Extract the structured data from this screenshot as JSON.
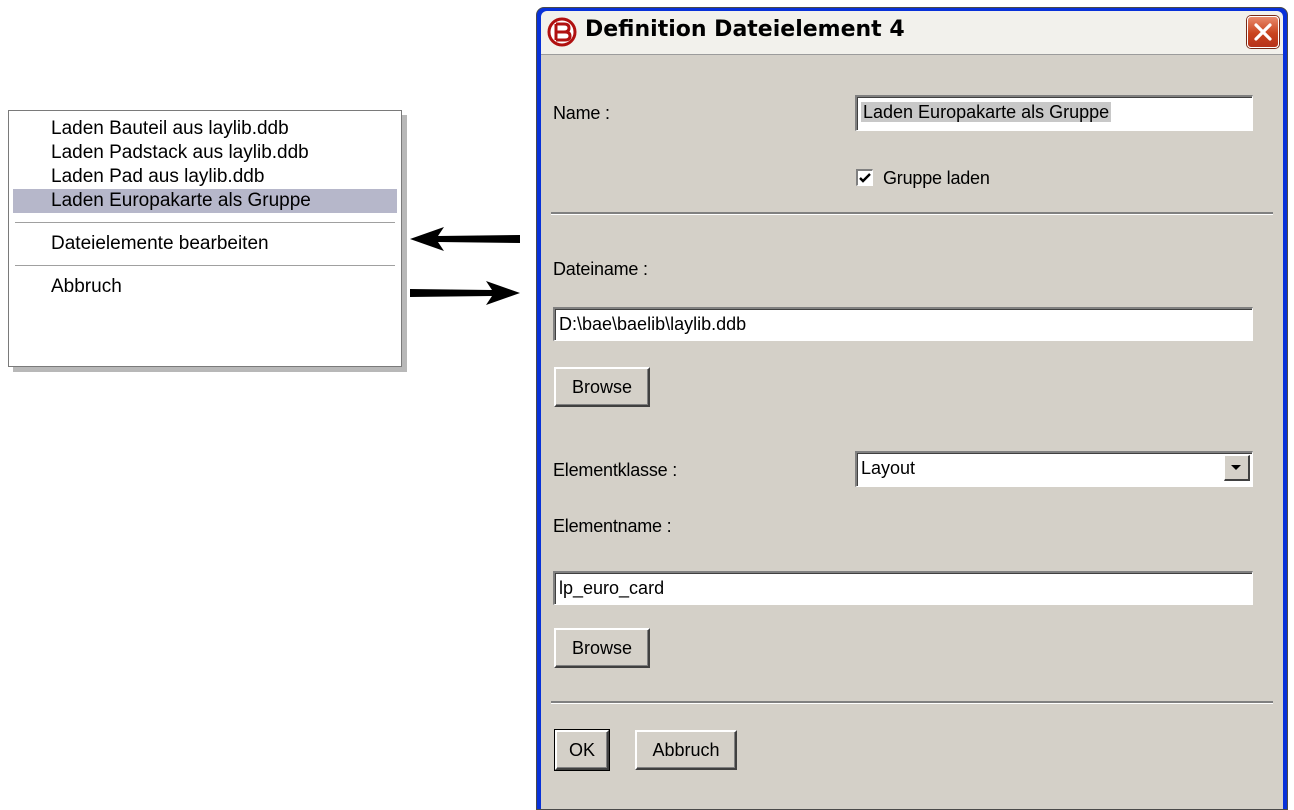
{
  "context_menu": {
    "items": [
      {
        "label": "Laden Bauteil aus laylib.ddb",
        "selected": false
      },
      {
        "label": "Laden Padstack aus laylib.ddb",
        "selected": false
      },
      {
        "label": "Laden Pad aus laylib.ddb",
        "selected": false
      },
      {
        "label": "Laden Europakarte als Gruppe",
        "selected": true
      }
    ],
    "edit_label": "Dateielemente bearbeiten",
    "cancel_label": "Abbruch"
  },
  "dialog": {
    "title": "Definition Dateielement 4",
    "name_label": "Name :",
    "name_value": "Laden Europakarte als Gruppe",
    "group_checkbox_label": "Gruppe laden",
    "group_checked": true,
    "filename_label": "Dateiname :",
    "filename_value": "D:\\bae\\baelib\\laylib.ddb",
    "browse_label": "Browse",
    "element_class_label": "Elementklasse :",
    "element_class_value": "Layout",
    "element_name_label": "Elementname :",
    "element_name_value": "lp_euro_card",
    "browse2_label": "Browse",
    "ok_label": "OK",
    "cancel_label": "Abbruch"
  },
  "colors": {
    "menu_highlight": "#b6b7ca",
    "dialog_face": "#d4d0c8",
    "title_border": "#0831d9",
    "close_button": "#c9441e"
  }
}
